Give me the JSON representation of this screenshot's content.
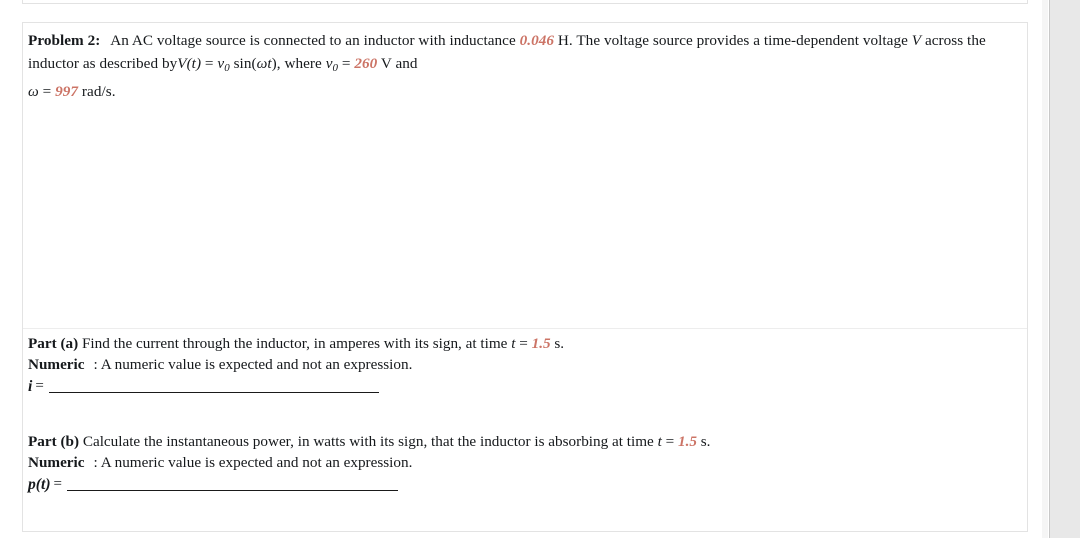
{
  "theme": {
    "page_background": "#ffffff",
    "card_background": "#ffffff",
    "card_border": "#e3e3e3",
    "text_color": "#16191c",
    "highlight_value_color": "#cc7466",
    "divider_color": "#ededed",
    "side_panel_color": "#e8e8e8",
    "blank_line_color": "#1a1a1a"
  },
  "problem": {
    "label": "Problem 2:",
    "stem_part_1": "An AC voltage source is connected to an inductor with inductance",
    "inductance_value": "0.046",
    "inductance_unit": "H.",
    "stem_part_2": "The voltage source provides a time-dependent voltage",
    "voltage_symbol": "V",
    "stem_part_3": "across the inductor as described by",
    "equation": {
      "lhs_symbol": "V",
      "lhs_arg": "(t)",
      "equals": "=",
      "rhs_symbol": "v",
      "rhs_subscript": "0",
      "rhs_function": "sin(",
      "rhs_omega": "ω",
      "rhs_time": "t",
      "rhs_close": "),"
    },
    "stem_part_4": "where",
    "v0_symbol": "v",
    "v0_subscript": "0",
    "v0_equals": "=",
    "v0_value": "260",
    "v0_unit": "V and",
    "omega_symbol": "ω",
    "omega_equals": "=",
    "omega_value": "997",
    "omega_unit": "rad/s."
  },
  "parts": [
    {
      "id": "part-a",
      "label": "Part (a)",
      "prompt_before_value": "Find the current through the inductor, in amperes with its sign, at time",
      "time_symbol": "t",
      "time_equals": "=",
      "time_value": "1.5",
      "time_unit": "s.",
      "answer_type": "Numeric",
      "answer_type_note": ": A numeric value is expected and not an expression.",
      "answer_variable": "i",
      "answer_equals": "=",
      "answer_value": ""
    },
    {
      "id": "part-b",
      "label": "Part (b)",
      "prompt_before_value": "Calculate the instantaneous power, in watts with its sign, that the inductor is absorbing at time",
      "time_symbol": "t",
      "time_equals": "=",
      "time_value": "1.5",
      "time_unit": "s.",
      "answer_type": "Numeric",
      "answer_type_note": ": A numeric value is expected and not an expression.",
      "answer_variable": "p(t)",
      "answer_equals": "=",
      "answer_value": ""
    }
  ]
}
